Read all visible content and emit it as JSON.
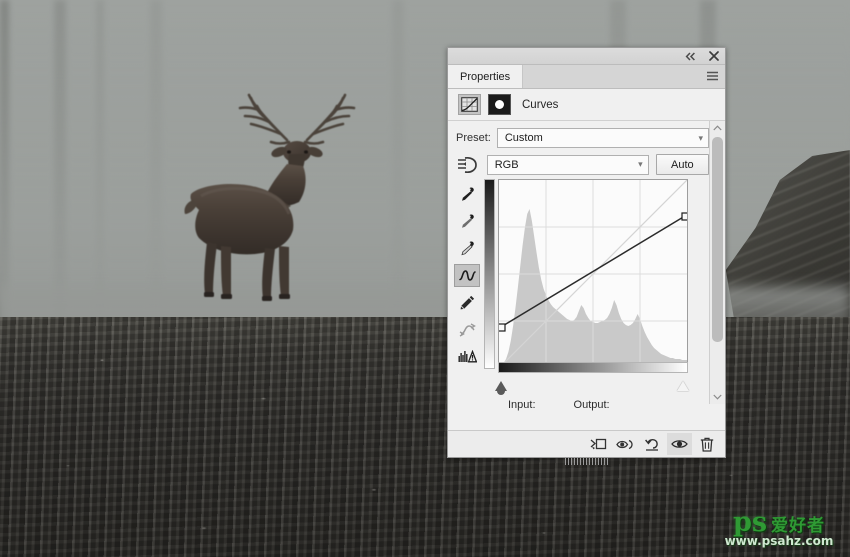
{
  "panel": {
    "title_tab": "Properties",
    "titlebar": {
      "collapse_icon": "double-chevron-left-icon",
      "close_icon": "close-icon"
    },
    "menu_icon": "hamburger-menu-icon",
    "adjustment": {
      "icon": "curves-adjustment-icon",
      "mask_icon": "layer-mask-thumbnail",
      "name": "Curves"
    },
    "preset": {
      "label": "Preset:",
      "value": "Custom",
      "chevron": "chevron-down-icon"
    },
    "channel": {
      "target_icon": "on-image-adjustment-icon",
      "value": "RGB",
      "chevron": "chevron-down-icon",
      "auto_label": "Auto"
    },
    "tools": [
      {
        "name": "sample-black-point-eyedropper",
        "icon": "eyedropper-icon",
        "active": false
      },
      {
        "name": "sample-gray-point-eyedropper",
        "icon": "eyedropper-icon",
        "active": false
      },
      {
        "name": "sample-white-point-eyedropper",
        "icon": "eyedropper-icon",
        "active": false
      },
      {
        "name": "edit-points-curve-tool",
        "icon": "curve-icon",
        "active": true
      },
      {
        "name": "draw-curve-pencil-tool",
        "icon": "pencil-icon",
        "active": false
      },
      {
        "name": "smooth-curve-tool",
        "icon": "smooth-curve-icon",
        "active": false
      },
      {
        "name": "curves-display-options",
        "icon": "histogram-warning-icon",
        "active": false
      }
    ],
    "graph": {
      "input_label": "Input:",
      "output_label": "Output:",
      "input_value": "",
      "output_value": "",
      "black_slider": "black-point-slider",
      "white_slider": "white-point-slider"
    },
    "scrollbar": {
      "up_icon": "chevron-up-icon",
      "down_icon": "chevron-down-icon"
    },
    "footer_buttons": [
      {
        "name": "clip-to-layer-button",
        "icon": "clip-to-layer-icon",
        "active": false
      },
      {
        "name": "view-previous-state-button",
        "icon": "eye-previous-state-icon",
        "active": false
      },
      {
        "name": "reset-adjustment-button",
        "icon": "reset-arrow-icon",
        "active": false
      },
      {
        "name": "toggle-layer-visibility-button",
        "icon": "eye-icon",
        "active": true
      },
      {
        "name": "delete-adjustment-layer-button",
        "icon": "trash-icon",
        "active": false
      }
    ]
  },
  "chart_data": {
    "type": "line",
    "title": "Curves RGB tone curve with histogram",
    "xlabel": "Input",
    "ylabel": "Output",
    "xlim": [
      0,
      255
    ],
    "ylim": [
      0,
      255
    ],
    "grid": true,
    "legend": "none",
    "series": [
      {
        "name": "tone-curve",
        "points": [
          [
            0,
            56
          ],
          [
            255,
            207
          ]
        ],
        "control_points": [
          {
            "input": 0,
            "output": 56
          },
          {
            "input": 255,
            "output": 207
          }
        ]
      },
      {
        "name": "baseline-identity",
        "points": [
          [
            0,
            0
          ],
          [
            255,
            255
          ]
        ]
      }
    ],
    "histogram": {
      "name": "rgb-composite-histogram",
      "bins": [
        2,
        3,
        5,
        9,
        16,
        28,
        46,
        68,
        95,
        124,
        152,
        176,
        194,
        200,
        186,
        164,
        140,
        120,
        104,
        92,
        84,
        78,
        73,
        69,
        66,
        63,
        60,
        57,
        54,
        52,
        50,
        49,
        50,
        54,
        62,
        70,
        66,
        58,
        52,
        49,
        47,
        46,
        46,
        47,
        48,
        50,
        53,
        58,
        66,
        76,
        70,
        60,
        52,
        47,
        44,
        43,
        44,
        47,
        52,
        58,
        52,
        44,
        36,
        29,
        23,
        18,
        14,
        11,
        8,
        6,
        5,
        4,
        3,
        2,
        2,
        1,
        1,
        1,
        0,
        0
      ]
    }
  },
  "image": {
    "subject": "red-deer-stag-in-misty-forest",
    "description": "A red deer stag standing on dark gravel ground in dense grey fog with faint tree trunks behind and a dark rock face on the right."
  },
  "watermark": {
    "brand": "ps",
    "brand_cn": "爱好者",
    "url": "www.psahz.com"
  },
  "colors": {
    "panel_bg": "#f0f0f0",
    "panel_border": "#9a9a9a",
    "histogram_fill": "#c9c9c9",
    "curve_line": "#2b2b2b",
    "accent_green": "#2f9a34"
  }
}
